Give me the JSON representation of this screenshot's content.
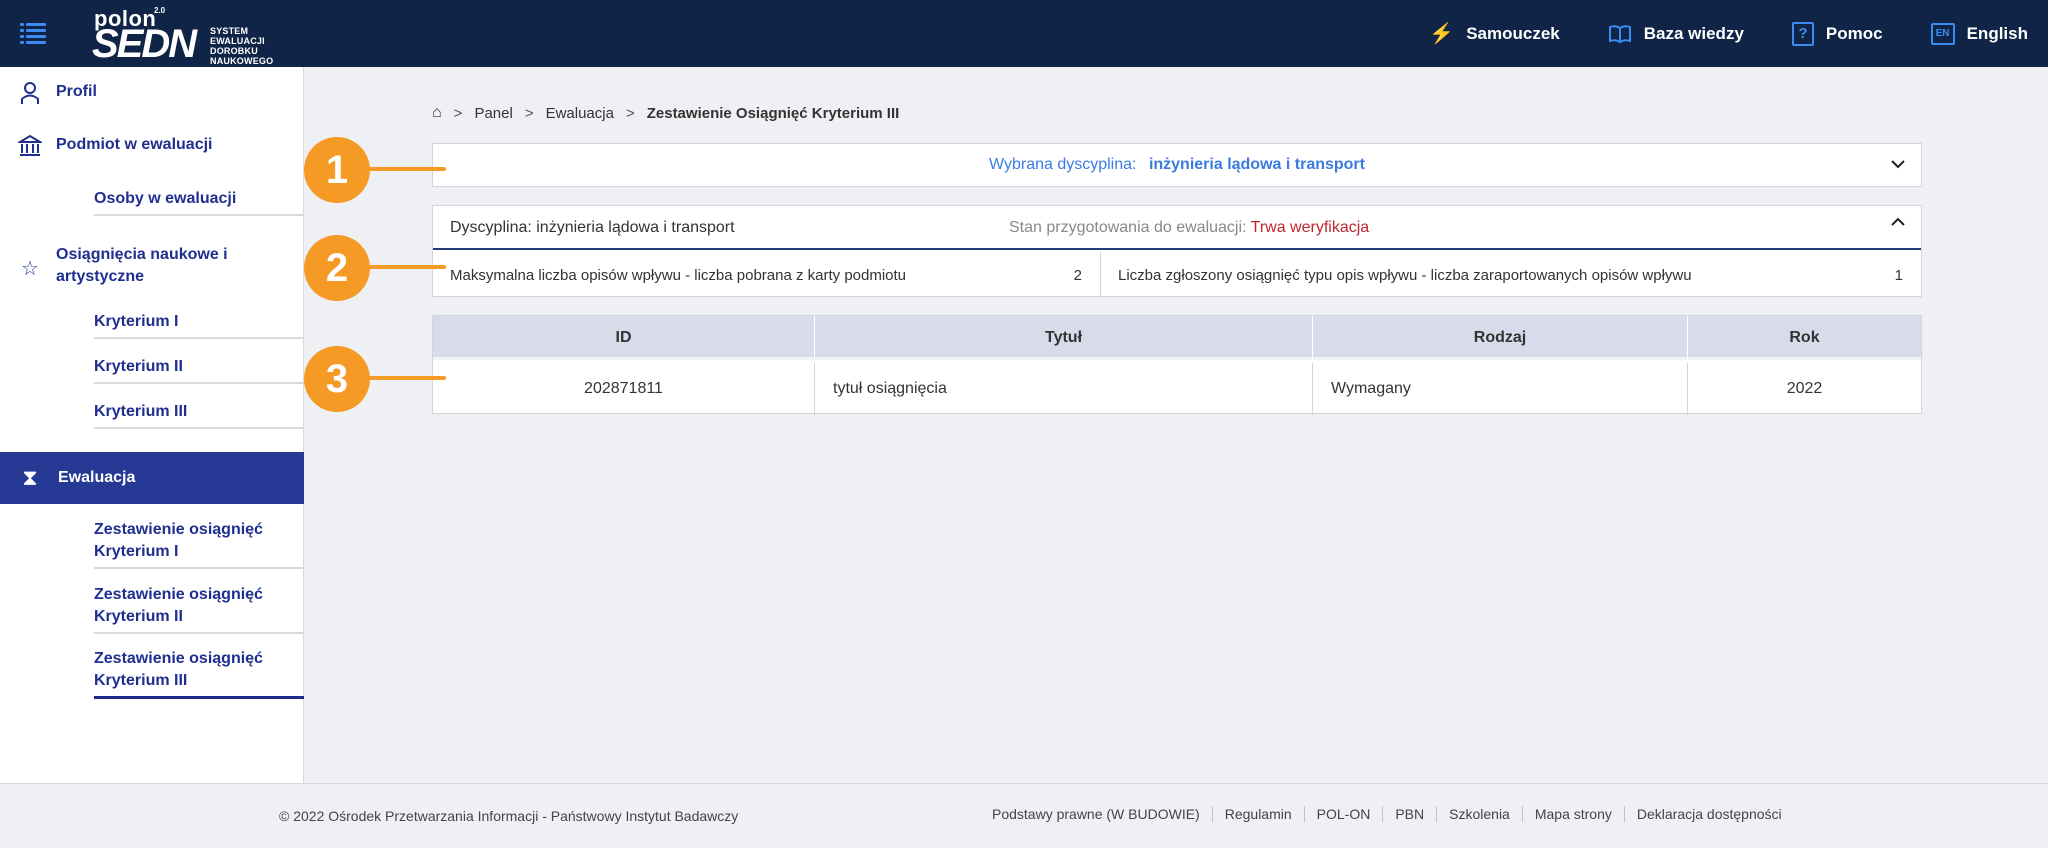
{
  "header": {
    "logo": {
      "polon": "polon",
      "version": "2.0",
      "sedn": "SEDN",
      "tagline": [
        "SYSTEM",
        "EWALUACJI",
        "DOROBKU",
        "NAUKOWEGO"
      ]
    },
    "links": [
      {
        "label": "Samouczek",
        "icon": "lightning-icon"
      },
      {
        "label": "Baza wiedzy",
        "icon": "book-icon"
      },
      {
        "label": "Pomoc",
        "icon": "help-icon"
      },
      {
        "label": "English",
        "icon": "en-flag-icon",
        "badge": "EN"
      }
    ]
  },
  "sidebar": {
    "profil": "Profil",
    "podmiot": "Podmiot w ewaluacji",
    "osoby": "Osoby w ewaluacji",
    "osiagniecia": [
      "Osiągnięcia naukowe i",
      "artystyczne"
    ],
    "kryteria": [
      "Kryterium I",
      "Kryterium II",
      "Kryterium III"
    ],
    "ewaluacja": "Ewaluacja",
    "zestawienia": [
      [
        "Zestawienie osiągnięć",
        "Kryterium I"
      ],
      [
        "Zestawienie osiągnięć",
        "Kryterium II"
      ],
      [
        "Zestawienie osiągnięć",
        "Kryterium III"
      ]
    ]
  },
  "breadcrumb": {
    "sep": ">",
    "items": [
      "Panel",
      "Ewaluacja"
    ],
    "current": "Zestawienie Osiągnięć Kryterium III"
  },
  "discipline_select": {
    "label": "Wybrana dyscyplina:",
    "value": "inżynieria lądowa i transport"
  },
  "discipline_info": {
    "name": "Dyscyplina: inżynieria lądowa i transport",
    "state_label": "Stan przygotowania do ewaluacji:",
    "state_value": "Trwa weryfikacja",
    "max_label": "Maksymalna liczba opisów wpływu - liczba pobrana z karty podmiotu",
    "max_value": "2",
    "reported_label": "Liczba zgłoszony osiągnięć typu opis wpływu - liczba zaraportowanych opisów wpływu",
    "reported_value": "1"
  },
  "table": {
    "headers": [
      "ID",
      "Tytuł",
      "Rodzaj",
      "Rok"
    ],
    "rows": [
      [
        "202871811",
        "tytuł osiągnięcia",
        "Wymagany",
        "2022"
      ]
    ]
  },
  "callouts": [
    "1",
    "2",
    "3"
  ],
  "footer": {
    "copyright": "© 2022 Ośrodek Przetwarzania Informacji - Państwowy Instytut Badawczy",
    "links": [
      "Podstawy prawne (W BUDOWIE)",
      "Regulamin",
      "POL-ON",
      "PBN",
      "Szkolenia",
      "Mapa strony",
      "Deklaracja dostępności"
    ]
  },
  "colors": {
    "topbar": "#0f2447",
    "accent": "#3b8cf0",
    "nav": "#263995",
    "callout": "#f49a25",
    "state": "#c0262d"
  }
}
